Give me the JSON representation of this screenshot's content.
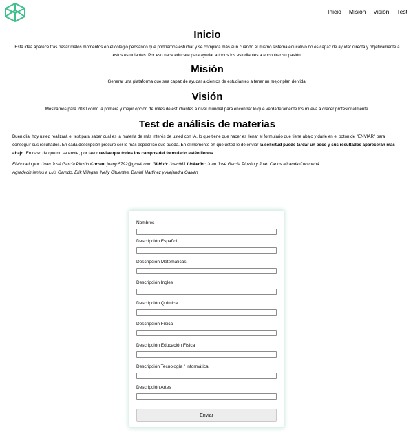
{
  "nav": {
    "logo_icon": "codepen-cube-icon",
    "logo_color": "#3fbf8c",
    "items": [
      "Inicio",
      "Misión",
      "Visión",
      "Test"
    ]
  },
  "sections": {
    "inicio": {
      "title": "Inicio",
      "text": "Esta idea aparece tras pasar malos momentos en el colegio pensando que podríamos estudiar y se complica más aun cuando el mismo sistema educativo no es capaz de ayudar directa y objetivamente a estos estudiantes. Por eso nace educare para ayudar a todos los estudiantes a encontrar su pasión."
    },
    "mision": {
      "title": "Misión",
      "text": "Generar una plataforma que sea capaz de ayudar a cientos de estudiantes a tener un mejor plan de vida."
    },
    "vision": {
      "title": "Visión",
      "text": "Mostrarnos para 2030 como la primera y mejor opción de miles de estudiantes a nivel mundial para encontrar lo que verdaderamente los mueva a crecer profesionalmente."
    },
    "test": {
      "title": "Test de análisis de materias",
      "intro_1": "Buen día, hoy usted realizará el test para saber cual es la materia de más interés de usted con IA, lo que tiene que hacer es llenar el formulario que tiene abajo y darle en el botón de \"ENVIAR\" para conseguir sus resultados. En cada descripción procure ser lo más específico que pueda. En el momento en que usted le dé enviar ",
      "intro_bold_1": "la solicitud puede tardar un poco y sus resultados aparecerán mas abajo",
      "intro_2": ". En caso de que no se envíe, por favor ",
      "intro_bold_2": "revise que todos los campos del formulario estén llenos",
      "intro_3": ".",
      "credits_prefix": "Elaborado por: Juan José García Pinzón ",
      "credits_correo_label": "Correo:",
      "credits_correo": " juanjo5792@gmail.com ",
      "credits_github_label": "GitHub:",
      "credits_github": " Juan961 ",
      "credits_linkedin_label": "LinkedIn:",
      "credits_linkedin": " Juan José García Pinzón y Juan Carlos Miranda Cucunubá",
      "credits_thanks": "Agradecimientos a Luis Garrido, Erik Villegas, Nelly Cifuentes, Daniel Martínez y Alejandra Galván"
    }
  },
  "form": {
    "fields": [
      {
        "label": "Nombres",
        "value": ""
      },
      {
        "label": "Descripción Español",
        "value": ""
      },
      {
        "label": "Descripción Matemáticas",
        "value": ""
      },
      {
        "label": "Descripción Ingles",
        "value": ""
      },
      {
        "label": "Descripción Química",
        "value": ""
      },
      {
        "label": "Descripción Física",
        "value": ""
      },
      {
        "label": "Descripción Educación Física",
        "value": ""
      },
      {
        "label": "Descripción Tecnología / Informática",
        "value": ""
      },
      {
        "label": "Descripción Artes",
        "value": ""
      }
    ],
    "submit_label": "Enviar"
  }
}
